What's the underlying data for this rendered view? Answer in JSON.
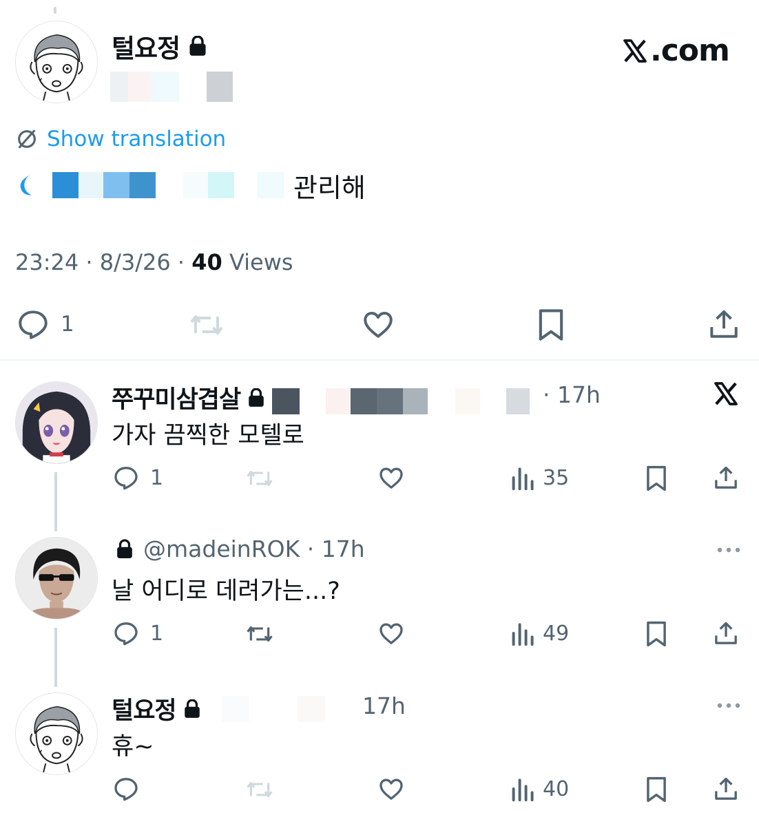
{
  "main_tweet": {
    "display_name": "털요정",
    "show_translation_label": "Show translation",
    "text": "관리해",
    "time": "23:24",
    "date": "8/3/26",
    "views_count": "40",
    "views_label": "Views",
    "reply_count": "1"
  },
  "brand": {
    "logo_text": ".com"
  },
  "replies": [
    {
      "display_name": "쭈꾸미삼겹살",
      "time": "17h",
      "text": "가자 끔찍한 모텔로",
      "reply_count": "1",
      "view_count": "35"
    },
    {
      "handle": "@madeinROK",
      "time": "17h",
      "text": "날 어디로 데려가는...?",
      "reply_count": "1",
      "view_count": "49"
    },
    {
      "display_name": "털요정",
      "time": "17h",
      "text": "휴~",
      "reply_count": "",
      "view_count": "40"
    }
  ],
  "colors": {
    "accent": "#1d9bf0",
    "muted": "#536471",
    "text": "#0f1419",
    "divider": "#eff3f4"
  },
  "icons": [
    "lock-icon",
    "x-logo-icon",
    "translate-icon",
    "reply-icon",
    "retweet-icon",
    "like-icon",
    "bookmark-icon",
    "share-icon",
    "views-icon",
    "more-icon"
  ]
}
